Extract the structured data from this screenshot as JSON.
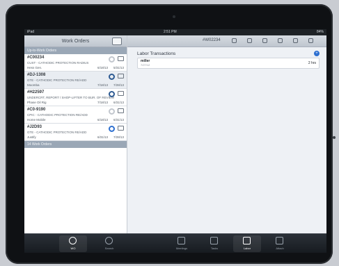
{
  "status": {
    "carrier": "iPad",
    "time": "2:51 PM",
    "battery": "84%"
  },
  "left": {
    "title": "Work Orders",
    "group1": "Up-to-Work Orders",
    "group2": "14 Work Orders",
    "orders": [
      {
        "id": "#C00234",
        "desc": "CUST - CATHODIC PROTECTION RADIUS",
        "name": "Hess Gen.",
        "date1": "6/18/13",
        "date2": "5/31/13",
        "icon": "pending-icon"
      },
      {
        "id": "#DJ-1308",
        "desc": "GTE - CATHODIC PROTECTION RE/ADD",
        "name": "Moomba",
        "date1": "7/18/13",
        "date2": "7/28/13",
        "icon": "progress-icon"
      },
      {
        "id": "#H22597",
        "desc": "UNDERCRT, REPORT / SHOP-LIFTER TO BUR. OF REVIEW",
        "name": "Phase Oil Rig",
        "date1": "7/18/13",
        "date2": "6/31/13",
        "icon": "progress-icon"
      },
      {
        "id": "#C0-9190",
        "desc": "CPIC - CATHODIC PROTECTION RE/ADD",
        "name": "Home Mobile",
        "date1": "6/18/13",
        "date2": "6/31/13",
        "icon": "pending-icon"
      },
      {
        "id": "#J2D93",
        "desc": "GTE - CATHODIC PROTECTION RE/ADD",
        "name": "Justify",
        "date1": "6/31/13",
        "date2": "7/28/13",
        "icon": "active-icon"
      }
    ]
  },
  "right": {
    "wo_number": "#W02234",
    "panel_title": "Labor Transactions",
    "transaction": {
      "name": "miller",
      "sub": "7/27/12",
      "hours": "2 hrs"
    }
  },
  "tabs": [
    {
      "label": "WO",
      "icon": "wo-icon"
    },
    {
      "label": "Search",
      "icon": "search-icon"
    },
    {
      "label": "Meetings",
      "icon": "calendar-icon"
    },
    {
      "label": "Tasks",
      "icon": "tasks-icon"
    },
    {
      "label": "Labor",
      "icon": "labor-icon"
    },
    {
      "label": "Attach",
      "icon": "attach-icon"
    }
  ],
  "accent": "#2d6fd0"
}
